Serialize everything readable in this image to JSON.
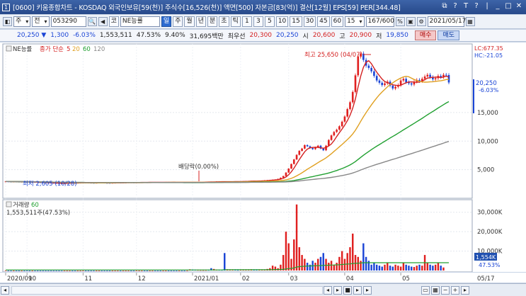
{
  "window": {
    "app_number": "1",
    "title": "[0600] 키움종합차트 - KOSDAQ 외국인보유[59(천)] 주식수[16,526(천)] 액면[500] 자본금[83(억)] 결산[12월] EPS[59] PER[344.48]",
    "buttons": [
      "⧉",
      "?",
      "T",
      "?",
      "|",
      "_",
      "□",
      "✕"
    ]
  },
  "toolbar": {
    "tab_main": "주",
    "tab_prev": "전",
    "stock_code": "053290",
    "code_btn": "코",
    "stock_name": "NE능률",
    "periods": [
      "일",
      "주",
      "월",
      "년",
      "분",
      "초",
      "틱"
    ],
    "active_period": "일",
    "intervals": [
      "1",
      "3",
      "5",
      "10",
      "15",
      "30",
      "45",
      "60"
    ],
    "interval_select": "15",
    "count": "167/600",
    "date": "2021/05/17"
  },
  "quote": {
    "price": "20,250",
    "change": "1,300",
    "change_pct": "-6.03%",
    "volume": "1,553,511",
    "vol_ratio": "47.53%",
    "turnover": "9.40%",
    "amount": "31,695백만",
    "best_label": "최우선",
    "best_ask": "20,300",
    "best_bid": "20,250",
    "open_label": "시",
    "open": "20,600",
    "high_label": "고",
    "high": "20,900",
    "low_label": "저",
    "low": "19,850",
    "buy": "매수",
    "sell": "매도"
  },
  "legend_price": {
    "name": "NE능률",
    "ma_label": "종가 단순",
    "ma": [
      "5",
      "20",
      "60",
      "120"
    ],
    "ma_colors": [
      "#d42020",
      "#e0a020",
      "#20a030",
      "#888888"
    ]
  },
  "legend_volume": {
    "name": "거래량",
    "ma": "60",
    "current": "1,553,511주(47.53%)"
  },
  "annotations": {
    "high": "최고 25,650 (04/07)",
    "low": "최저 2,605 (10/28)",
    "dividend": "배당락(0.00%)",
    "lc": "LC:677.35",
    "hc": "HC:-21.05",
    "price_tag": "20,250",
    "price_tag_pct": "-6.03%",
    "vol_tag": "1,554K",
    "vol_tag_pct": "47.53%"
  },
  "chart_data": [
    {
      "type": "line",
      "title": "",
      "y_ticks": [
        "15,000",
        "10,000",
        "5,000"
      ],
      "y_tick_values": [
        15000,
        10000,
        5000
      ],
      "ylim": [
        1000,
        26500
      ],
      "x_labels": [
        "2020/09",
        "10",
        "11",
        "12",
        "2021/01",
        "02",
        "03",
        "04",
        "05"
      ],
      "x_label_positions": [
        0,
        8,
        29,
        49,
        70,
        88,
        106,
        127,
        148
      ],
      "end_label": "05/17",
      "n_bars": 167,
      "close": [
        2950,
        2930,
        2900,
        2940,
        2910,
        2880,
        2900,
        2870,
        2850,
        2820,
        2860,
        2830,
        2800,
        2780,
        2760,
        2740,
        2720,
        2700,
        2680,
        2650,
        2620,
        2605,
        2640,
        2680,
        2720,
        2700,
        2690,
        2710,
        2730,
        2760,
        2740,
        2720,
        2700,
        2690,
        2710,
        2740,
        2730,
        2700,
        2690,
        2680,
        2700,
        2720,
        2740,
        2730,
        2750,
        2760,
        2780,
        2770,
        2760,
        2780,
        2790,
        2800,
        2790,
        2780,
        2800,
        2820,
        2810,
        2800,
        2790,
        2810,
        2830,
        2820,
        2810,
        2800,
        2790,
        2800,
        2790,
        2780,
        2800,
        2820,
        2790,
        2770,
        2800,
        2830,
        2850,
        2880,
        2860,
        2840,
        2900,
        2950,
        2920,
        2900,
        2880,
        2900,
        2920,
        2940,
        2930,
        2920,
        2950,
        2980,
        3000,
        3020,
        3050,
        3030,
        3000,
        3050,
        3100,
        3150,
        3180,
        3200,
        3250,
        3300,
        3400,
        3600,
        3900,
        4500,
        5200,
        6000,
        6800,
        7600,
        8300,
        8700,
        9300,
        9100,
        8800,
        8600,
        8900,
        9200,
        8700,
        8400,
        9200,
        10200,
        11000,
        11600,
        12000,
        12600,
        13400,
        14300,
        15600,
        16800,
        18600,
        21500,
        24800,
        25300,
        24200,
        23200,
        22800,
        22200,
        21400,
        20600,
        20200,
        19800,
        20100,
        20400,
        19700,
        19200,
        19500,
        19800,
        20600,
        20900,
        20300,
        20100,
        19900,
        20400,
        20700,
        20500,
        20900,
        21300,
        21600,
        21200,
        20800,
        21000,
        21400,
        21200,
        21600,
        21550,
        20250
      ],
      "ma5_end": 20700,
      "ma20_end": 20300,
      "ma60_end": 14100,
      "ma120_end": 8600
    },
    {
      "type": "bar",
      "title": "",
      "y_ticks": [
        "30,000K",
        "20,000K",
        "10,000K"
      ],
      "y_tick_values": [
        30000,
        20000,
        10000
      ],
      "ylim": [
        0,
        35000
      ],
      "unit": "K",
      "values_k": [
        40,
        25,
        30,
        20,
        25,
        20,
        18,
        22,
        25,
        20,
        18,
        15,
        20,
        22,
        25,
        18,
        20,
        22,
        25,
        30,
        28,
        60,
        40,
        30,
        25,
        20,
        18,
        22,
        25,
        20,
        18,
        20,
        25,
        22,
        20,
        18,
        20,
        22,
        25,
        20,
        18,
        16,
        20,
        22,
        25,
        20,
        18,
        20,
        22,
        20,
        18,
        20,
        22,
        20,
        18,
        20,
        22,
        20,
        18,
        20,
        25,
        20,
        18,
        16,
        20,
        22,
        20,
        18,
        60,
        600,
        500,
        300,
        250,
        200,
        180,
        200,
        250,
        1200,
        800,
        400,
        300,
        250,
        9000,
        600,
        500,
        400,
        300,
        250,
        300,
        350,
        400,
        500,
        600,
        400,
        350,
        300,
        400,
        500,
        800,
        1200,
        2500,
        2000,
        1200,
        3000,
        8000,
        20000,
        14000,
        6000,
        16000,
        34000,
        12000,
        8000,
        6000,
        4000,
        3000,
        5000,
        4000,
        6000,
        7000,
        9000,
        6000,
        4000,
        5000,
        3000,
        4000,
        7000,
        10000,
        6000,
        9000,
        12000,
        19000,
        8000,
        7000,
        5000,
        14000,
        7000,
        5000,
        3000,
        4000,
        3000,
        2500,
        2000,
        3000,
        4000,
        2500,
        2000,
        3000,
        2500,
        2000,
        4000,
        3000,
        2500,
        2000,
        1800,
        2500,
        3000,
        2500,
        8000,
        4000,
        3000,
        2500,
        3000,
        4000,
        2500,
        1554
      ],
      "up": [
        1,
        0,
        0,
        1,
        0,
        0,
        1,
        0,
        0,
        0,
        1,
        0,
        0,
        0,
        0,
        0,
        0,
        0,
        0,
        0,
        0,
        0,
        1,
        1,
        1,
        0,
        0,
        1,
        1,
        1,
        0,
        0,
        0,
        0,
        1,
        1,
        0,
        0,
        0,
        0,
        1,
        1,
        1,
        0,
        1,
        1,
        1,
        0,
        0,
        1,
        1,
        1,
        0,
        0,
        1,
        1,
        0,
        0,
        0,
        1,
        1,
        0,
        0,
        0,
        0,
        1,
        0,
        0,
        1,
        1,
        0,
        0,
        1,
        1,
        1,
        1,
        0,
        0,
        1,
        1,
        0,
        0,
        0,
        1,
        1,
        1,
        0,
        0,
        1,
        1,
        1,
        1,
        1,
        0,
        0,
        1,
        1,
        1,
        1,
        1,
        1,
        1,
        1,
        1,
        1,
        1,
        1,
        1,
        1,
        1,
        1,
        1,
        1,
        0,
        0,
        0,
        1,
        1,
        0,
        0,
        1,
        1,
        1,
        1,
        1,
        1,
        1,
        1,
        1,
        1,
        1,
        1,
        1,
        1,
        0,
        0,
        0,
        0,
        0,
        0,
        0,
        0,
        1,
        1,
        0,
        0,
        1,
        1,
        1,
        1,
        0,
        0,
        0,
        1,
        1,
        0,
        1,
        1,
        1,
        0,
        0,
        1,
        1,
        0,
        1,
        0,
        0
      ],
      "ma60": [
        300,
        300,
        300,
        300,
        300,
        300,
        300,
        300,
        300,
        300,
        300,
        300,
        300,
        300,
        300,
        300,
        300,
        300,
        300,
        300,
        300,
        300,
        300,
        300,
        300,
        300,
        300,
        300,
        300,
        300,
        300,
        300,
        300,
        300,
        300,
        300,
        300,
        300,
        300,
        300,
        300,
        300,
        300,
        300,
        300,
        300,
        300,
        300,
        300,
        300,
        300,
        300,
        300,
        300,
        300,
        300,
        300,
        300,
        300,
        300,
        300,
        300,
        300,
        300,
        300,
        300,
        300,
        300,
        300,
        300,
        300,
        300,
        300,
        300,
        300,
        300,
        300,
        300,
        300,
        300,
        300,
        300,
        400,
        400,
        400,
        400,
        400,
        400,
        400,
        400,
        400,
        400,
        400,
        400,
        400,
        400,
        400,
        400,
        400,
        400,
        450,
        500,
        500,
        550,
        600,
        800,
        1000,
        1100,
        1300,
        1800,
        2000,
        2100,
        2200,
        2300,
        2350,
        2400,
        2450,
        2500,
        2550,
        2650,
        2700,
        2750,
        2800,
        2850,
        2900,
        3000,
        3100,
        3200,
        3300,
        3400,
        3600,
        3700,
        3800,
        3850,
        4000,
        4000,
        4000,
        4000,
        4000,
        4000,
        4000,
        4000,
        4000,
        4000,
        4000,
        4000,
        4000,
        4000,
        4000,
        4000,
        4000,
        4000,
        4000,
        4000,
        4000,
        4000,
        4000,
        4000,
        4000,
        4000,
        4000,
        4000,
        4000,
        4000,
        4000,
        4000,
        4000
      ]
    }
  ]
}
